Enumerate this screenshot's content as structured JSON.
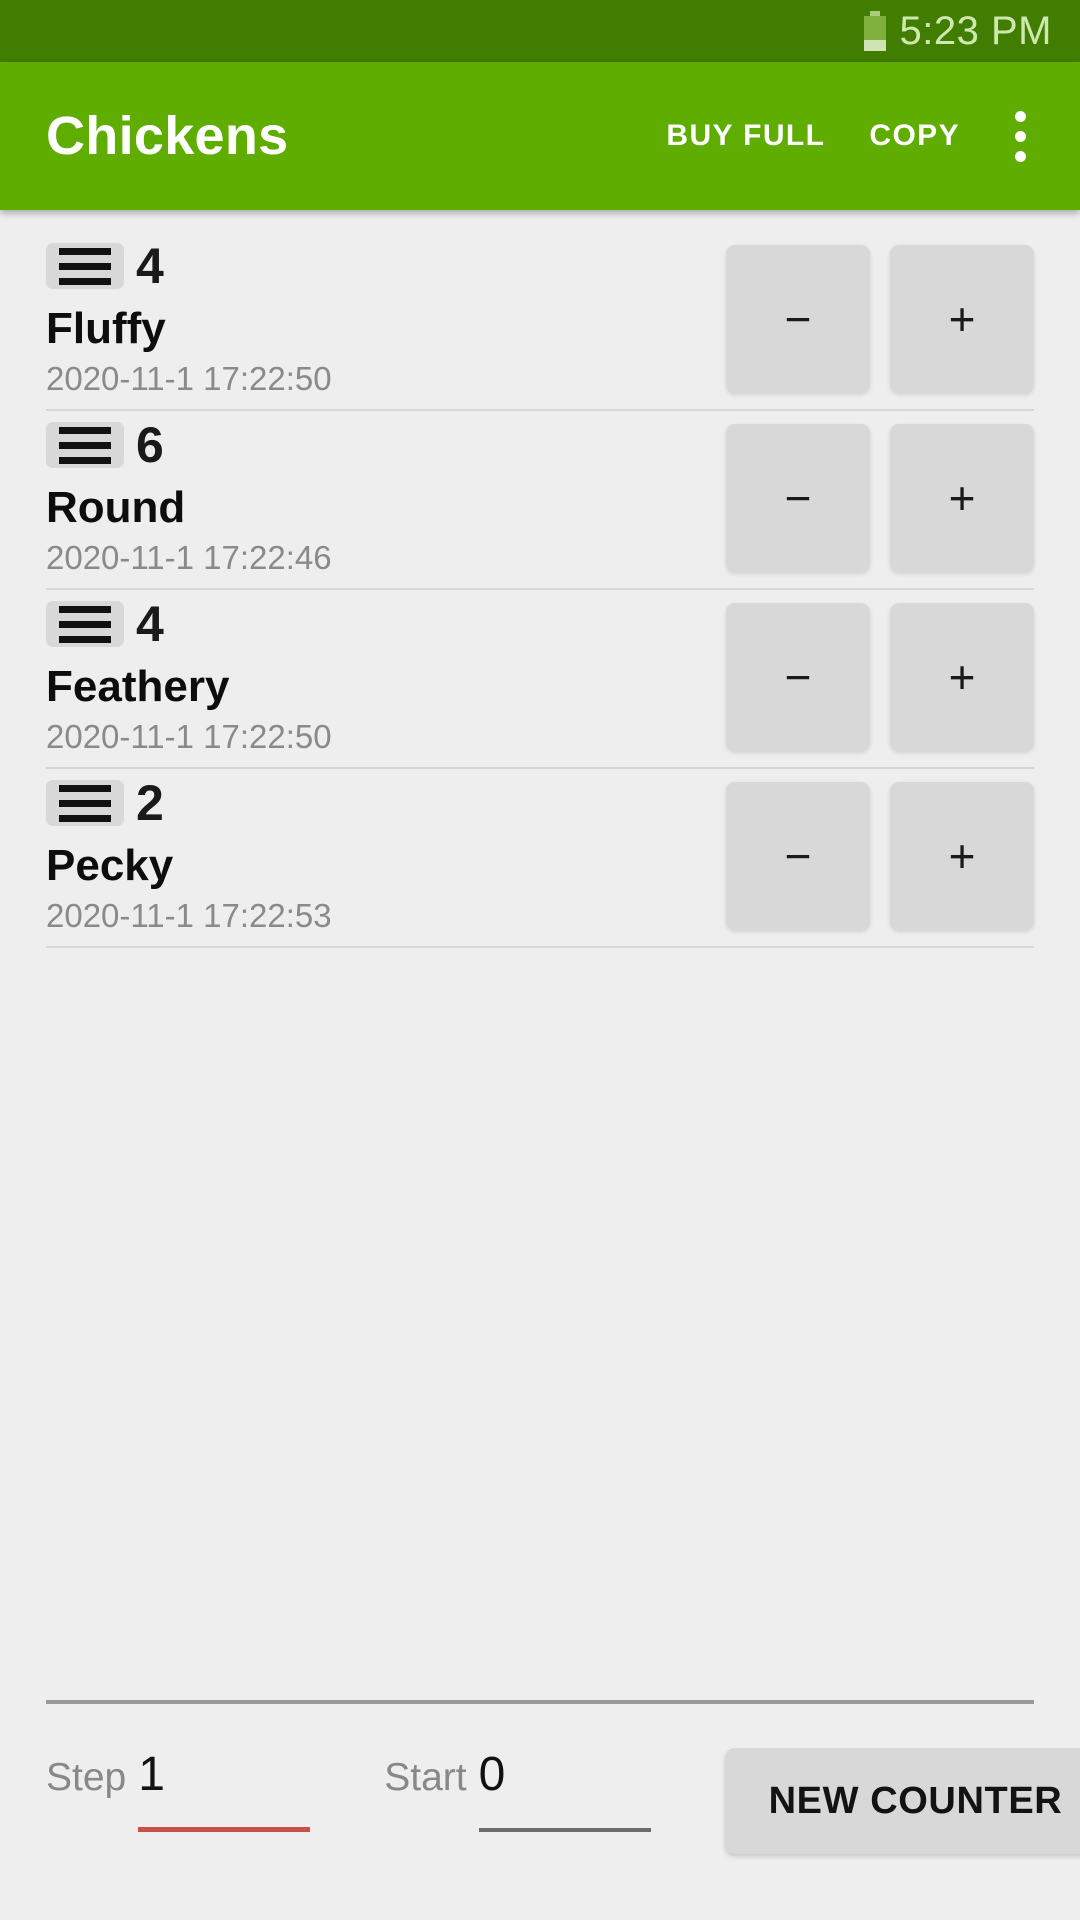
{
  "status_bar": {
    "time": "5:23 PM",
    "battery_icon": "battery-icon"
  },
  "app_bar": {
    "title": "Chickens",
    "actions": [
      {
        "label": "BUY FULL",
        "name": "buy-full-button"
      },
      {
        "label": "COPY",
        "name": "copy-button"
      }
    ],
    "overflow_icon": "more-vertical-icon"
  },
  "colors": {
    "status_bar_bg": "#417d00",
    "app_bar_bg": "#5ead00",
    "content_bg": "#eeeeee",
    "button_bg": "#d8d8d8",
    "accent_underline": "#c8504a",
    "plain_underline": "#6b6b6b"
  },
  "row_controls": {
    "decrement_label": "−",
    "increment_label": "+",
    "drag_handle_icon": "drag-handle-icon"
  },
  "counters": [
    {
      "count": "4",
      "name": "Fluffy",
      "timestamp": "2020-11-1 17:22:50"
    },
    {
      "count": "6",
      "name": "Round",
      "timestamp": "2020-11-1 17:22:46"
    },
    {
      "count": "4",
      "name": "Feathery",
      "timestamp": "2020-11-1 17:22:50"
    },
    {
      "count": "2",
      "name": "Pecky",
      "timestamp": "2020-11-1 17:22:53"
    }
  ],
  "bottom_bar": {
    "step_label": "Step",
    "step_value": "1",
    "start_label": "Start",
    "start_value": "0",
    "new_counter_label": "NEW COUNTER"
  }
}
